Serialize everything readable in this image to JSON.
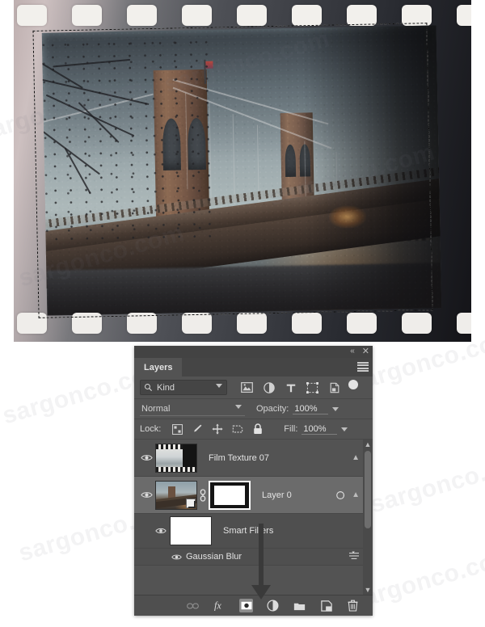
{
  "watermark": {
    "text": "sargonco.com"
  },
  "canvas": {
    "description": "Film strip photo of the Brooklyn Bridge with a dashed marching-ants selection around the photo layer",
    "selection_label": "marching-ants-selection"
  },
  "panel": {
    "title": "Layers",
    "titlebar": {
      "collapse_label": "«",
      "close_label": "✕"
    },
    "menu_label": "panel-menu",
    "filter": {
      "kind_label": "Kind",
      "search_icon": "search-icon",
      "icons": [
        {
          "name": "filter-pixel-layers-icon",
          "glyph": "▣"
        },
        {
          "name": "filter-adjustment-layers-icon",
          "glyph": "◑"
        },
        {
          "name": "filter-type-layers-icon",
          "glyph": "T"
        },
        {
          "name": "filter-shape-layers-icon",
          "glyph": "⬚"
        },
        {
          "name": "filter-smart-objects-icon",
          "glyph": "❐"
        }
      ],
      "toggle_name": "filter-enable-toggle"
    },
    "blend": {
      "mode": "Normal",
      "opacity_label": "Opacity:",
      "opacity_value": "100%"
    },
    "lock": {
      "label": "Lock:",
      "items": [
        {
          "name": "lock-transparent-pixels",
          "glyph": "⬚"
        },
        {
          "name": "lock-image-pixels",
          "glyph": "✎"
        },
        {
          "name": "lock-position",
          "glyph": "✥"
        },
        {
          "name": "lock-artboard-nesting",
          "glyph": "⛶"
        },
        {
          "name": "lock-all",
          "glyph": "🔒"
        }
      ],
      "fill_label": "Fill:",
      "fill_value": "100%"
    },
    "layers": [
      {
        "name": "Film Texture 07",
        "visible": true,
        "selected": false,
        "thumbnail": "film-strip-thumbnail"
      },
      {
        "name": "Layer 0",
        "visible": true,
        "selected": true,
        "thumbnail": "bridge-photo-thumbnail",
        "smart_object_badge": true,
        "link_icon": "link-icon",
        "mask_thumbnail": "layer-mask-thumbnail",
        "smart_filter_icon": "smart-filter-icon",
        "collapse_chevron": "˄"
      }
    ],
    "smart_filters": {
      "label": "Smart Filters",
      "visible": true,
      "filters": [
        {
          "name": "Gaussian Blur",
          "visible": true,
          "options_icon": "filter-blending-options-icon"
        }
      ]
    },
    "bottom_toolbar": [
      {
        "name": "link-layers-button",
        "glyph": "⚭",
        "state": "disabled"
      },
      {
        "name": "layer-style-fx-button",
        "glyph": "fx",
        "state": "normal"
      },
      {
        "name": "add-layer-mask-button",
        "glyph": "◉",
        "state": "active"
      },
      {
        "name": "new-adjustment-layer-button",
        "glyph": "◑",
        "state": "normal"
      },
      {
        "name": "new-group-button",
        "glyph": "▰",
        "state": "normal"
      },
      {
        "name": "new-layer-button",
        "glyph": "⧉",
        "state": "normal"
      },
      {
        "name": "delete-layer-button",
        "glyph": "🗑",
        "state": "normal"
      }
    ],
    "annotation": {
      "name": "pointer-arrow-to-add-layer-mask"
    }
  }
}
